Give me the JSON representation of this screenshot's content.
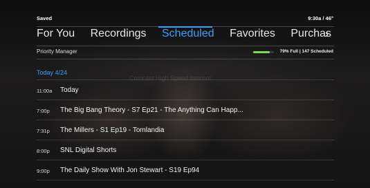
{
  "status": {
    "left": "Saved",
    "right": "9:30a / 46°"
  },
  "tabs": [
    {
      "label": "For You",
      "active": false
    },
    {
      "label": "Recordings",
      "active": false
    },
    {
      "label": "Scheduled",
      "active": true
    },
    {
      "label": "Favorites",
      "active": false
    },
    {
      "label": "Purchas",
      "active": false
    }
  ],
  "next_icon": "chevron-right-icon",
  "priority_manager": {
    "label": "Priority Manager",
    "status": "79% Full | 147 Scheduled",
    "percent_full": 79,
    "bar_color": "#7ed957"
  },
  "date_header": "Today  4/24",
  "background_caption": "Comcast High Speed Internet",
  "rows": [
    {
      "time": "11:00a",
      "title": "Today"
    },
    {
      "time": "7:00p",
      "title": "The Big Bang Theory - S7 Ep21 - The Anything Can Happ..."
    },
    {
      "time": "7:31p",
      "title": "The Millers - S1 Ep19 - Tomlandia"
    },
    {
      "time": "8:00p",
      "title": "SNL Digital Shorts"
    },
    {
      "time": "9:00p",
      "title": "The Daily Show With Jon Stewart - S19 Ep94"
    }
  ],
  "colors": {
    "accent": "#3aa0ff",
    "progress": "#7ed957"
  }
}
